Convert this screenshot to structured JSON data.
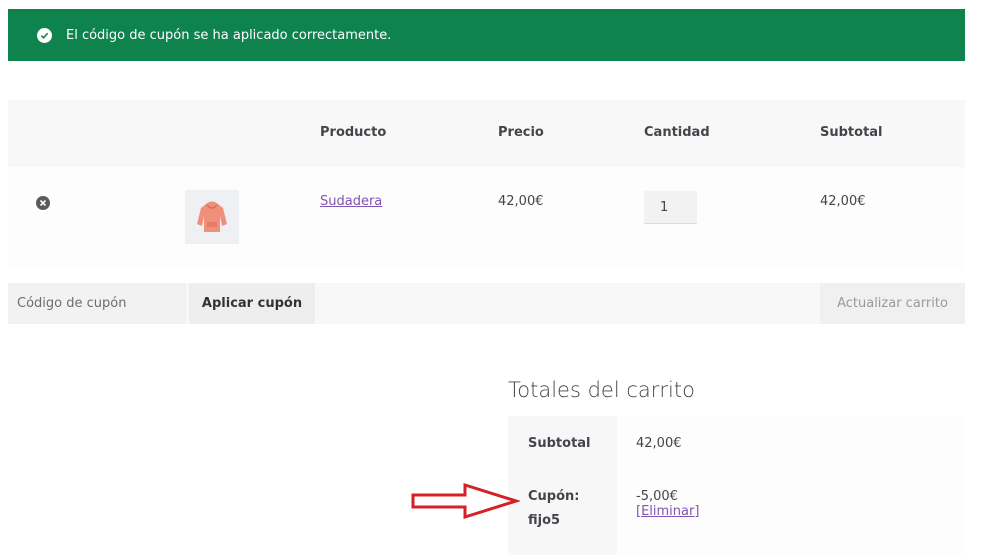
{
  "notice": {
    "message": "El código de cupón se ha aplicado correctamente.",
    "icon": "check-circle-icon",
    "color": "#0f834d"
  },
  "cart": {
    "headers": {
      "product": "Producto",
      "price": "Precio",
      "quantity": "Cantidad",
      "subtotal": "Subtotal"
    },
    "items": [
      {
        "name": "Sudadera",
        "price": "42,00€",
        "quantity": "1",
        "subtotal": "42,00€"
      }
    ]
  },
  "actions": {
    "coupon_placeholder": "Código de cupón",
    "apply_label": "Aplicar cupón",
    "update_label": "Actualizar carrito"
  },
  "totals": {
    "title": "Totales del carrito",
    "subtotal_label": "Subtotal",
    "subtotal_value": "42,00€",
    "coupon_label": "Cupón:",
    "coupon_code": "fijo5",
    "coupon_value": "-5,00€",
    "remove_label": "[Eliminar]"
  },
  "colors": {
    "accent_link": "#7f54b3",
    "annotation_arrow": "#d42026"
  }
}
